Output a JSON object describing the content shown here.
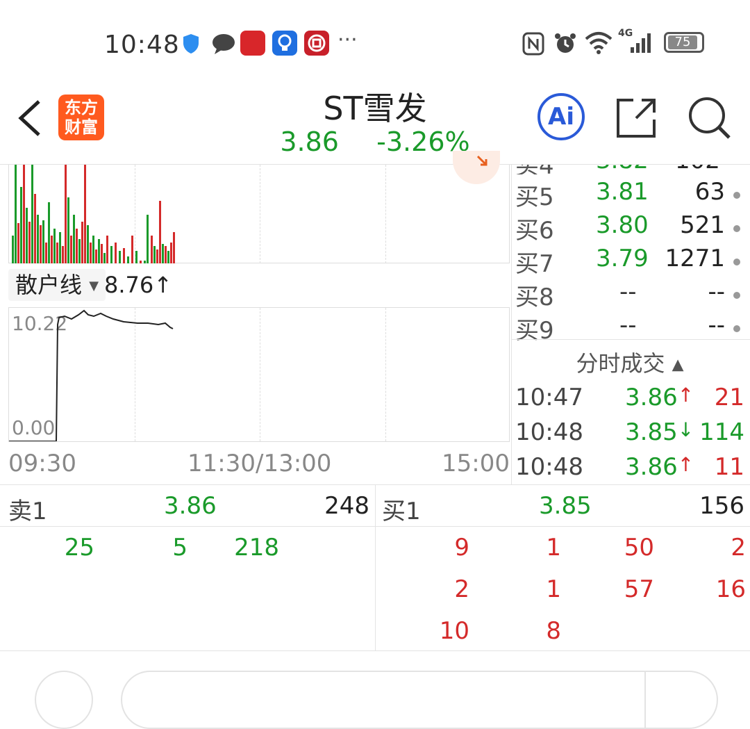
{
  "status_bar": {
    "time": "10:48",
    "more": "···",
    "battery": "75",
    "network": "4G"
  },
  "header": {
    "logo_line1": "东方",
    "logo_line2": "财富",
    "title": "ST雪发",
    "price": "3.86",
    "change": "-3.26%",
    "ai_label": "Ai"
  },
  "chart": {
    "indicator_name": "散户线",
    "indicator_value": "8.76↑",
    "y_top": "10.22",
    "y_bottom": "0.00",
    "x_start": "09:30",
    "x_mid": "11:30/13:00",
    "x_end": "15:00"
  },
  "order_book": [
    {
      "label": "买5",
      "price": "3.81",
      "vol": "63"
    },
    {
      "label": "买6",
      "price": "3.80",
      "vol": "521"
    },
    {
      "label": "买7",
      "price": "3.79",
      "vol": "1271"
    },
    {
      "label": "买8",
      "price": "--",
      "vol": "--"
    },
    {
      "label": "买9",
      "price": "--",
      "vol": "--"
    }
  ],
  "trades": {
    "title": "分时成交",
    "rows": [
      {
        "time": "10:47",
        "price": "3.86↑",
        "vol": "21"
      },
      {
        "time": "10:48",
        "price": "3.85↓",
        "vol": "114"
      },
      {
        "time": "10:48",
        "price": "3.86↑",
        "vol": "11"
      }
    ]
  },
  "bottom": {
    "sell1_label": "卖1",
    "sell1_price": "3.86",
    "sell1_vol": "248",
    "buy1_label": "买1",
    "buy1_price": "3.85",
    "buy1_vol": "156",
    "sell_queue": [
      "25",
      "5",
      "218"
    ],
    "buy_queue": [
      [
        "9",
        "1",
        "50",
        "2"
      ],
      [
        "2",
        "1",
        "57",
        "16"
      ],
      [
        "10",
        "8"
      ]
    ]
  },
  "colors": {
    "up": "#d42a2a",
    "down": "#1a9a2a",
    "brand": "#ff5a1f",
    "ai": "#2a5ad8"
  }
}
